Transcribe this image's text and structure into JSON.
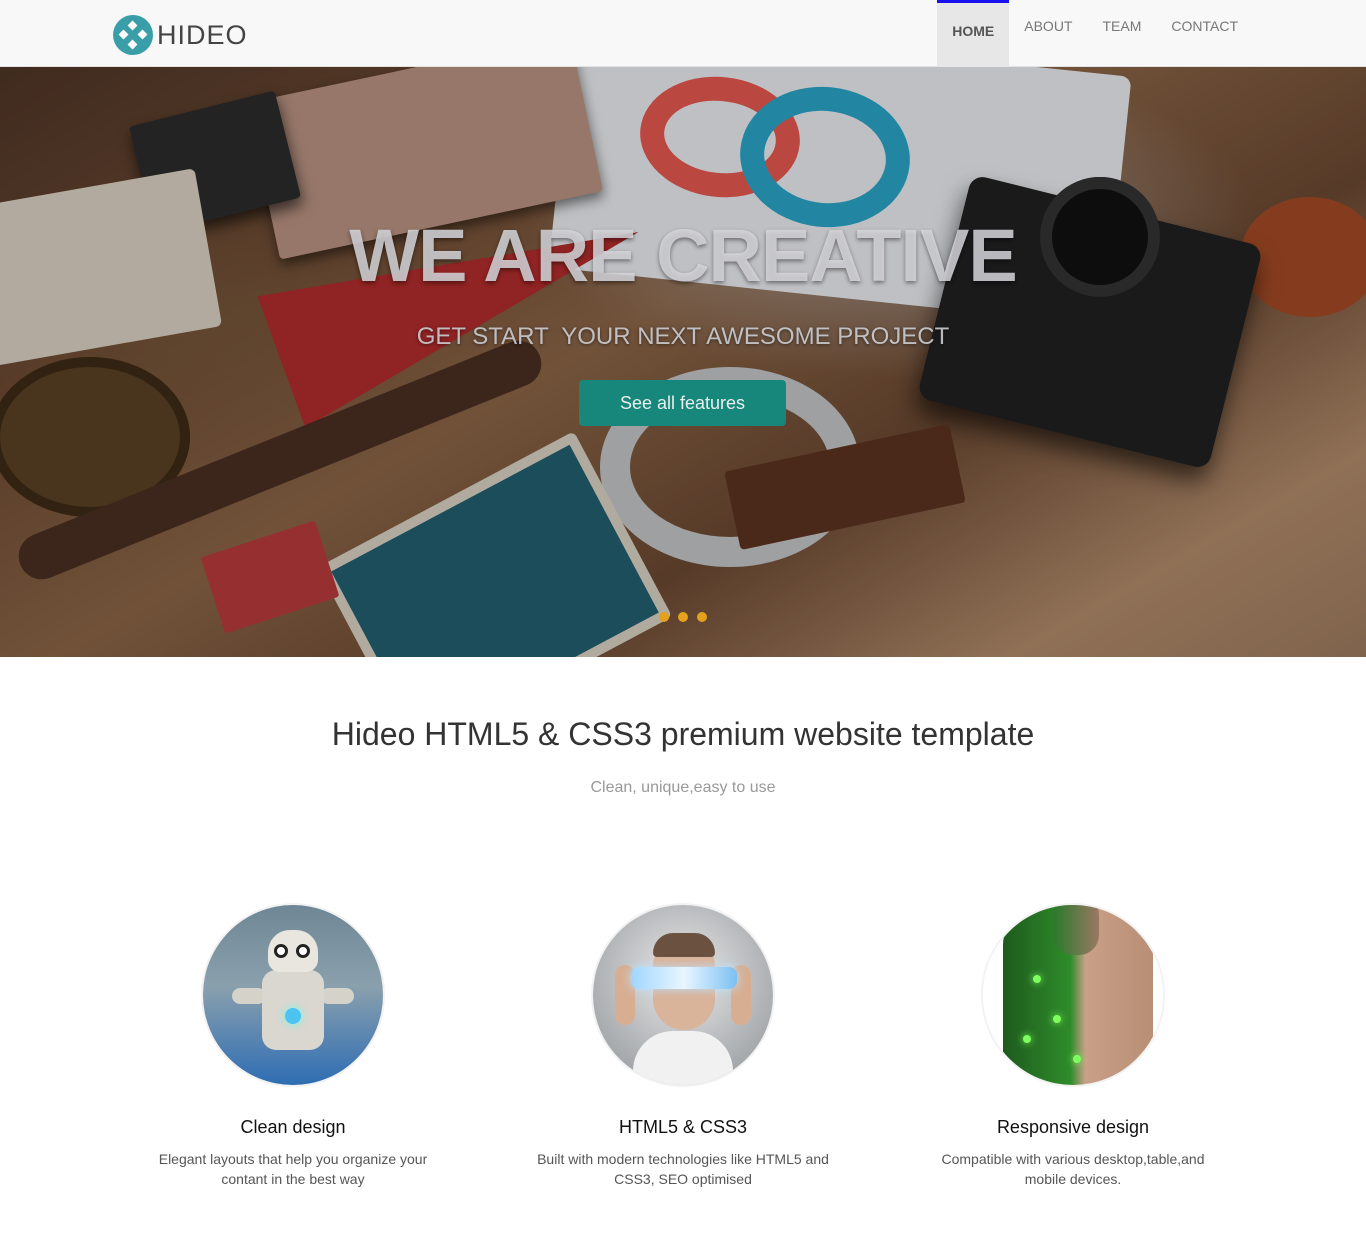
{
  "brand": {
    "name": "HIDEO"
  },
  "nav": {
    "items": [
      {
        "label": "HOME",
        "active": true
      },
      {
        "label": "ABOUT",
        "active": false
      },
      {
        "label": "TEAM",
        "active": false
      },
      {
        "label": "CONTACT",
        "active": false
      }
    ]
  },
  "hero": {
    "title": "WE ARE CREATIVE",
    "subtitle": "GET START  YOUR NEXT AWESOME PROJECT",
    "cta_label": "See all features",
    "slides": 3
  },
  "intro": {
    "title": "Hideo HTML5 & CSS3 premium website template",
    "subtitle": "Clean, unique,easy to use"
  },
  "features": [
    {
      "title": "Clean design",
      "text": "Elegant layouts that help you organize your contant in the best way"
    },
    {
      "title": "HTML5 & CSS3",
      "text": "Built with modern technologies like HTML5 and CSS3, SEO optimised"
    },
    {
      "title": "Responsive design",
      "text": "Compatible with various desktop,table,and mobile devices."
    }
  ],
  "colors": {
    "brand_accent": "#3a9ea8",
    "cta": "#16877a",
    "active_nav_border": "#1a11f0",
    "slider_dot": "#e6a11c"
  }
}
